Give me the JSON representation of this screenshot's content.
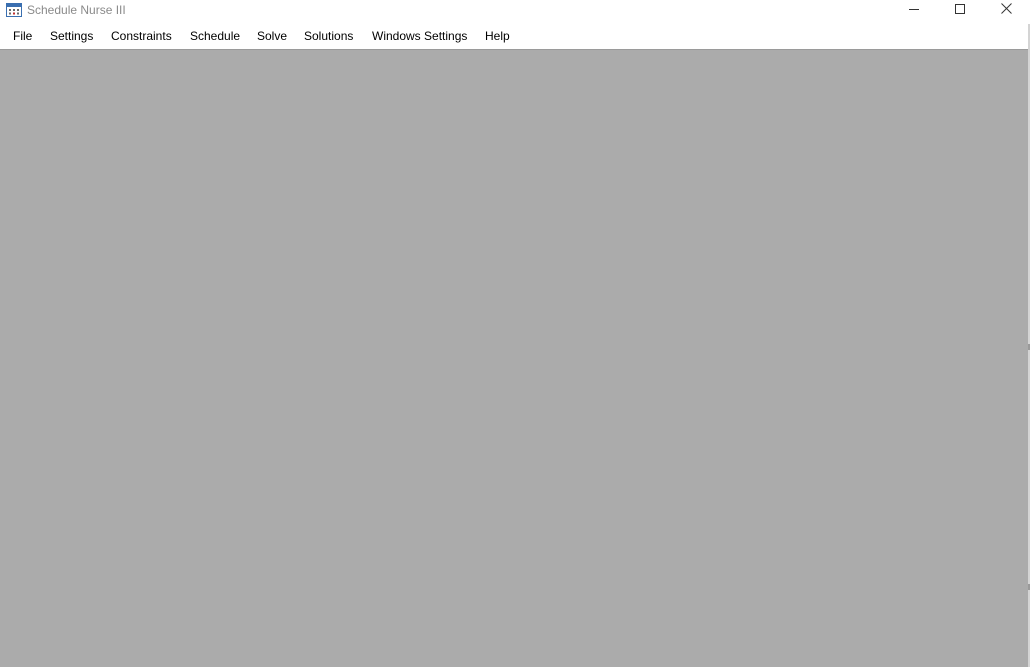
{
  "window": {
    "title": "Schedule Nurse III",
    "icon": "calendar-icon",
    "controls": {
      "minimize": "minimize-icon",
      "maximize": "maximize-icon",
      "close": "close-icon"
    }
  },
  "menubar": {
    "items": [
      {
        "label": "File"
      },
      {
        "label": "Settings"
      },
      {
        "label": "Constraints"
      },
      {
        "label": "Schedule"
      },
      {
        "label": "Solve"
      },
      {
        "label": "Solutions"
      },
      {
        "label": "Windows Settings"
      },
      {
        "label": "Help"
      }
    ]
  },
  "colors": {
    "client_background": "#ababab",
    "title_text": "#8a8a8a",
    "menu_text": "#000000"
  }
}
